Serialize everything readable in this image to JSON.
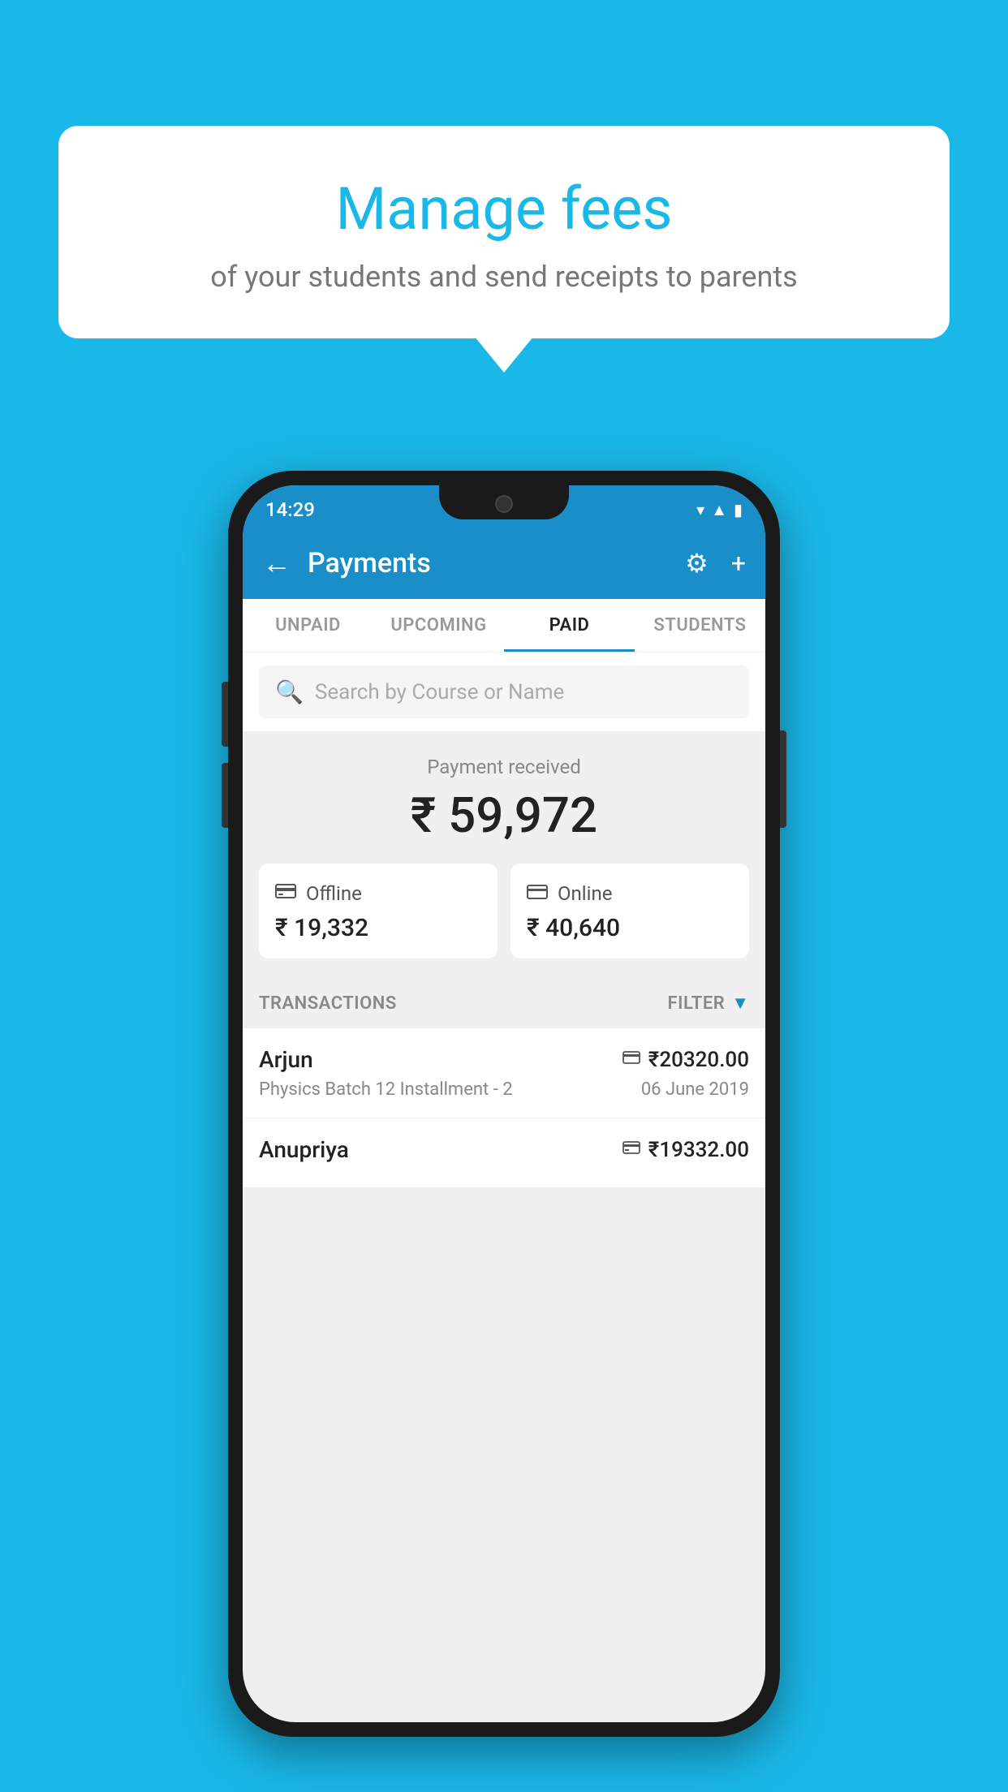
{
  "background_color": "#1ab8e8",
  "bubble": {
    "title": "Manage fees",
    "subtitle": "of your students and send receipts to parents"
  },
  "status_bar": {
    "time": "14:29",
    "icons": [
      "wifi",
      "signal",
      "battery"
    ]
  },
  "header": {
    "title": "Payments",
    "back_label": "←",
    "settings_label": "⚙",
    "add_label": "+"
  },
  "tabs": [
    {
      "label": "UNPAID",
      "active": false
    },
    {
      "label": "UPCOMING",
      "active": false
    },
    {
      "label": "PAID",
      "active": true
    },
    {
      "label": "STUDENTS",
      "active": false
    }
  ],
  "search": {
    "placeholder": "Search by Course or Name"
  },
  "payment_summary": {
    "label": "Payment received",
    "amount": "₹ 59,972"
  },
  "payment_cards": [
    {
      "label": "Offline",
      "amount": "₹ 19,332",
      "icon": "💳"
    },
    {
      "label": "Online",
      "amount": "₹ 40,640",
      "icon": "💳"
    }
  ],
  "transactions_header": {
    "label": "TRANSACTIONS",
    "filter_label": "FILTER"
  },
  "transactions": [
    {
      "name": "Arjun",
      "detail": "Physics Batch 12 Installment - 2",
      "amount": "₹20320.00",
      "date": "06 June 2019",
      "payment_type": "online"
    },
    {
      "name": "Anupriya",
      "detail": "",
      "amount": "₹19332.00",
      "date": "",
      "payment_type": "offline"
    }
  ]
}
